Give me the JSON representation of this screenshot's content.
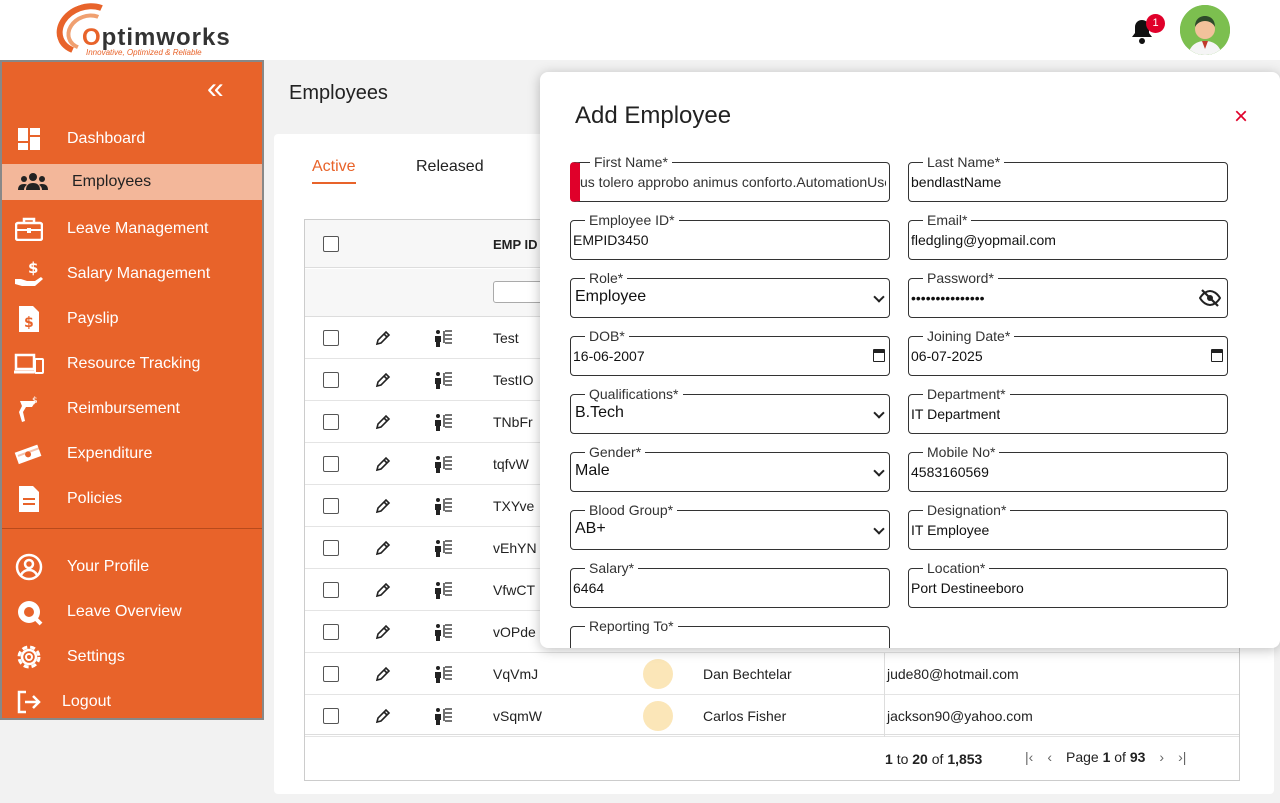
{
  "brand": {
    "name_pre": "",
    "name_o": "O",
    "name_post": "ptimworks",
    "tagline": "Innovative, Optimized & Reliable"
  },
  "header": {
    "notifications_count": "1"
  },
  "sidebar": {
    "collapse_glyph": "«",
    "items": [
      {
        "label": "Dashboard",
        "icon": "dashboard-icon"
      },
      {
        "label": "Employees",
        "icon": "users-icon",
        "active": true
      },
      {
        "label": "Leave Management",
        "icon": "briefcase-icon"
      },
      {
        "label": "Salary Management",
        "icon": "salary-icon"
      },
      {
        "label": "Payslip",
        "icon": "payslip-icon"
      },
      {
        "label": "Resource Tracking",
        "icon": "devices-icon"
      },
      {
        "label": "Reimbursement",
        "icon": "reimbursement-icon"
      },
      {
        "label": "Expenditure",
        "icon": "money-icon"
      },
      {
        "label": "Policies",
        "icon": "document-icon"
      },
      {
        "label": "Your Profile",
        "icon": "profile-icon"
      },
      {
        "label": "Leave Overview",
        "icon": "leave-overview-icon"
      },
      {
        "label": "Settings",
        "icon": "gear-icon"
      },
      {
        "label": "Logout",
        "icon": "logout-icon"
      }
    ]
  },
  "page": {
    "title": "Employees"
  },
  "tabs": {
    "active": "Active",
    "released": "Released"
  },
  "table": {
    "col_emp_id": "EMP ID",
    "rows": [
      {
        "id": "Test",
        "name": "",
        "email": ""
      },
      {
        "id": "TestIO",
        "name": "",
        "email": ""
      },
      {
        "id": "TNbFr",
        "name": "",
        "email": ""
      },
      {
        "id": "tqfvW",
        "name": "",
        "email": ""
      },
      {
        "id": "TXYve",
        "name": "",
        "email": ""
      },
      {
        "id": "vEhYN",
        "name": "",
        "email": ""
      },
      {
        "id": "VfwCT",
        "name": "",
        "email": ""
      },
      {
        "id": "vOPde",
        "name": "",
        "email": ""
      },
      {
        "id": "VqVmJ",
        "name": "Dan Bechtelar",
        "email": "jude80@hotmail.com"
      },
      {
        "id": "vSqmW",
        "name": "Carlos Fisher",
        "email": "jackson90@yahoo.com"
      }
    ],
    "footer": {
      "from": "1",
      "to_word": "to",
      "to": "20",
      "of_word": "of",
      "total": "1,853",
      "page_word": "Page",
      "page": "1",
      "page_of": "of",
      "pages": "93"
    }
  },
  "modal": {
    "title": "Add Employee",
    "close": "×",
    "fields": {
      "first_name": {
        "label": "First Name*",
        "value": "us tolero approbo animus conforto.AutomationUse"
      },
      "last_name": {
        "label": "Last Name*",
        "value": "bendlastName"
      },
      "employee_id": {
        "label": "Employee ID*",
        "value": "EMPID3450"
      },
      "email": {
        "label": "Email*",
        "value": "fledgling@yopmail.com"
      },
      "role": {
        "label": "Role*",
        "value": "Employee"
      },
      "password": {
        "label": "Password*",
        "value": "•••••••••••••••"
      },
      "dob": {
        "label": "DOB*",
        "value": "16-06-2007"
      },
      "joining_date": {
        "label": "Joining Date*",
        "value": "06-07-2025"
      },
      "qualifications": {
        "label": "Qualifications*",
        "value": "B.Tech"
      },
      "department": {
        "label": "Department*",
        "value": "IT Department"
      },
      "gender": {
        "label": "Gender*",
        "value": "Male"
      },
      "mobile": {
        "label": "Mobile No*",
        "value": "4583160569"
      },
      "blood_group": {
        "label": "Blood Group*",
        "value": "AB+"
      },
      "designation": {
        "label": "Designation*",
        "value": "IT Employee"
      },
      "salary": {
        "label": "Salary*",
        "value": "6464"
      },
      "location": {
        "label": "Location*",
        "value": "Port Destineeboro"
      },
      "reporting_to": {
        "label": "Reporting To*",
        "value": ""
      }
    }
  },
  "colors": {
    "accent": "#e8632a",
    "active_nav": "#f3b79a",
    "error": "#e0002a"
  }
}
